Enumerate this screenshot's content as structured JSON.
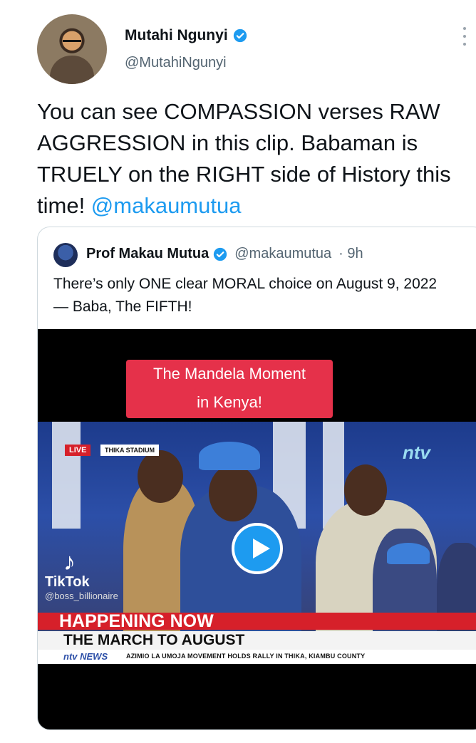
{
  "tweet": {
    "author_name": "Mutahi Ngunyi",
    "author_handle": "@MutahiNgunyi",
    "text": "You can see COMPASSION verses RAW AGGRESSION in this clip. Babaman is TRUELY on the RIGHT side of History this time! ",
    "mention": "@makaumutua",
    "verified_color": "#1d9bf0",
    "icons": [
      "verified-badge-icon",
      "more-options-icon"
    ]
  },
  "quoted": {
    "author_name": "Prof Makau Mutua",
    "author_handle": "@makaumutua",
    "time": "· 9h",
    "text": "There’s only ONE clear MORAL choice on August 9, 2022 — Baba, The FIFTH!",
    "video": {
      "caption_line1": "The Mandela Moment",
      "caption_line2": "in Kenya!",
      "live_label": "LIVE",
      "location_label": "THIKA STADIUM",
      "channel_logo": "ntv",
      "watermark_name": "TikTok",
      "watermark_user": "@boss_billionaire",
      "banner_top": "HAPPENING NOW",
      "banner_headline": "THE MARCH TO AUGUST",
      "ticker_logo": "ntv NEWS",
      "ticker_text": "AZIMIO LA UMOJA MOVEMENT HOLDS RALLY IN THIKA, KIAMBU COUNTY",
      "icons": [
        "play-icon",
        "tiktok-icon"
      ]
    }
  },
  "colors": {
    "accent": "#1d9bf0",
    "text_primary": "#0f1419",
    "text_secondary": "#536471",
    "caption_red": "#e5314a"
  }
}
